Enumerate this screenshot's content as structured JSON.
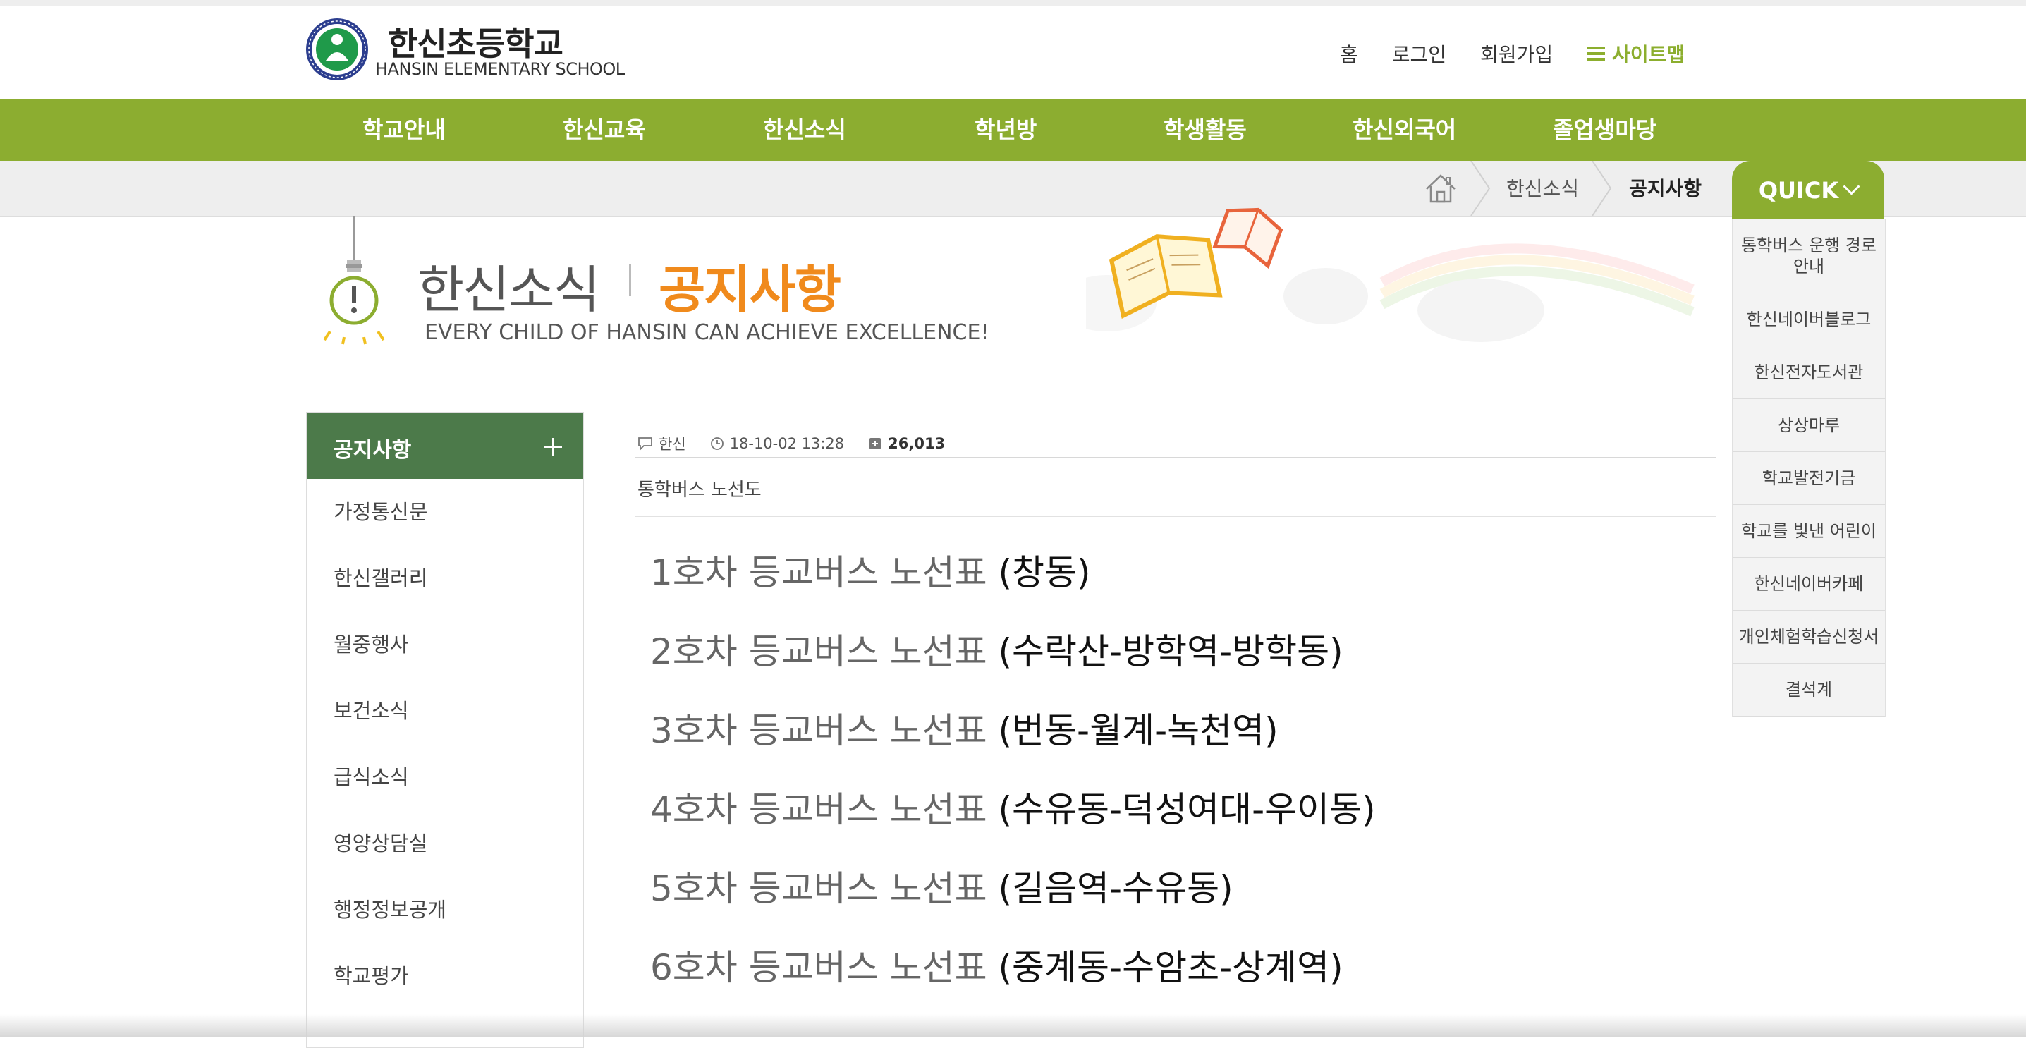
{
  "header": {
    "logo_title": "한신초등학교",
    "logo_subtitle": "HANSIN ELEMENTARY SCHOOL",
    "util_links": [
      "홈",
      "로그인",
      "회원가입"
    ],
    "sitemap_label": "사이트맵"
  },
  "gnb": [
    "학교안내",
    "한신교육",
    "한신소식",
    "학년방",
    "학생활동",
    "한신외국어",
    "졸업생마당"
  ],
  "breadcrumb": {
    "level1": "한신소식",
    "level2": "공지사항"
  },
  "quick": {
    "label": "QUICK",
    "items": [
      "통학버스 운행 경로 안내",
      "한신네이버블로그",
      "한신전자도서관",
      "상상마루",
      "학교발전기금",
      "학교를 빛낸 어린이",
      "한신네이버카페",
      "개인체험학습신청서",
      "결석계"
    ]
  },
  "page_title": {
    "section": "한신소식",
    "page": "공지사항",
    "slogan": "EVERY CHILD OF HANSIN CAN ACHIEVE EXCELLENCE!"
  },
  "lnb": {
    "active": "공지사항",
    "items": [
      "가정통신문",
      "한신갤러리",
      "월중행사",
      "보건소식",
      "급식소식",
      "영양상담실",
      "행정정보공개",
      "학교평가"
    ]
  },
  "article": {
    "author": "한신",
    "datetime": "18-10-02 13:28",
    "views": "26,013",
    "subject": "통학버스 노선도",
    "routes": [
      {
        "label": "1호차 등교버스 노선표",
        "stops": "(창동)"
      },
      {
        "label": "2호차 등교버스 노선표",
        "stops": "(수락산-방학역-방학동)"
      },
      {
        "label": "3호차 등교버스 노선표",
        "stops": "(번동-월계-녹천역)"
      },
      {
        "label": "4호차 등교버스 노선표",
        "stops": "(수유동-덕성여대-우이동)"
      },
      {
        "label": "5호차 등교버스 노선표",
        "stops": "(길음역-수유동)"
      },
      {
        "label": "6호차 등교버스 노선표",
        "stops": "(중계동-수암초-상계역)"
      }
    ]
  },
  "colors": {
    "green": "#8cad30",
    "dark_green": "#4c7a4a",
    "orange": "#f08a1c"
  }
}
